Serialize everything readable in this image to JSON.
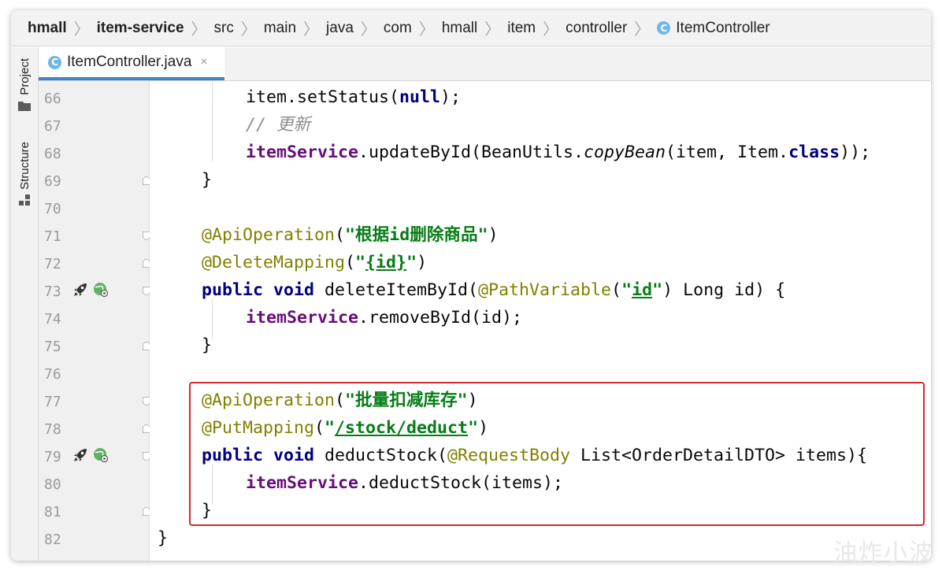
{
  "breadcrumb": {
    "items": [
      "hmall",
      "item-service",
      "src",
      "main",
      "java",
      "com",
      "hmall",
      "item",
      "controller",
      "ItemController"
    ]
  },
  "toolstrip": {
    "project_label": "Project",
    "structure_label": "Structure"
  },
  "tab": {
    "label": "ItemController.java",
    "close": "×"
  },
  "class_icon_letter": "C",
  "line_numbers": [
    "66",
    "67",
    "68",
    "69",
    "70",
    "71",
    "72",
    "73",
    "74",
    "75",
    "76",
    "77",
    "78",
    "79",
    "80",
    "81",
    "82"
  ],
  "code": {
    "l66": {
      "a": "item.setStatus(",
      "b": "null",
      "c": ");"
    },
    "l67": {
      "a": "// 更新"
    },
    "l68": {
      "a": "itemService",
      "b": ".updateById(BeanUtils.",
      "c": "copyBean",
      "d": "(item, Item.",
      "e": "class",
      "f": "));"
    },
    "l69": {
      "a": "}"
    },
    "l71": {
      "a": "@ApiOperation",
      "b": "(",
      "c": "\"根据id删除商品\"",
      "d": ")"
    },
    "l72": {
      "a": "@DeleteMapping",
      "b": "(",
      "c": "\"",
      "d": "{id}",
      "e": "\"",
      "f": ")"
    },
    "l73": {
      "a": "public void ",
      "b": "deleteItemById(",
      "c": "@PathVariable",
      "d": "(",
      "e": "\"",
      "f": "id",
      "g": "\"",
      "h": ") Long id) {"
    },
    "l74": {
      "a": "itemService",
      "b": ".removeById(id);"
    },
    "l75": {
      "a": "}"
    },
    "l77": {
      "a": "@ApiOperation",
      "b": "(",
      "c": "\"批量扣减库存\"",
      "d": ")"
    },
    "l78": {
      "a": "@PutMapping",
      "b": "(",
      "c": "\"",
      "d": "/stock/deduct",
      "e": "\"",
      "f": ")"
    },
    "l79": {
      "a": "public void ",
      "b": "deductStock(",
      "c": "@RequestBody",
      "d": " List<OrderDetailDTO> items){"
    },
    "l80": {
      "a": "itemService",
      "b": ".deductStock(items);"
    },
    "l81": {
      "a": "}"
    },
    "l82": {
      "a": "}"
    }
  },
  "watermark": "油炸小波",
  "colors": {
    "keyword": "#000080",
    "field": "#660e7a",
    "annotation": "#808000",
    "string": "#067d17",
    "comment": "#8c8c8c",
    "highlight_border": "#d62828",
    "tab_underline": "#4083c9"
  }
}
